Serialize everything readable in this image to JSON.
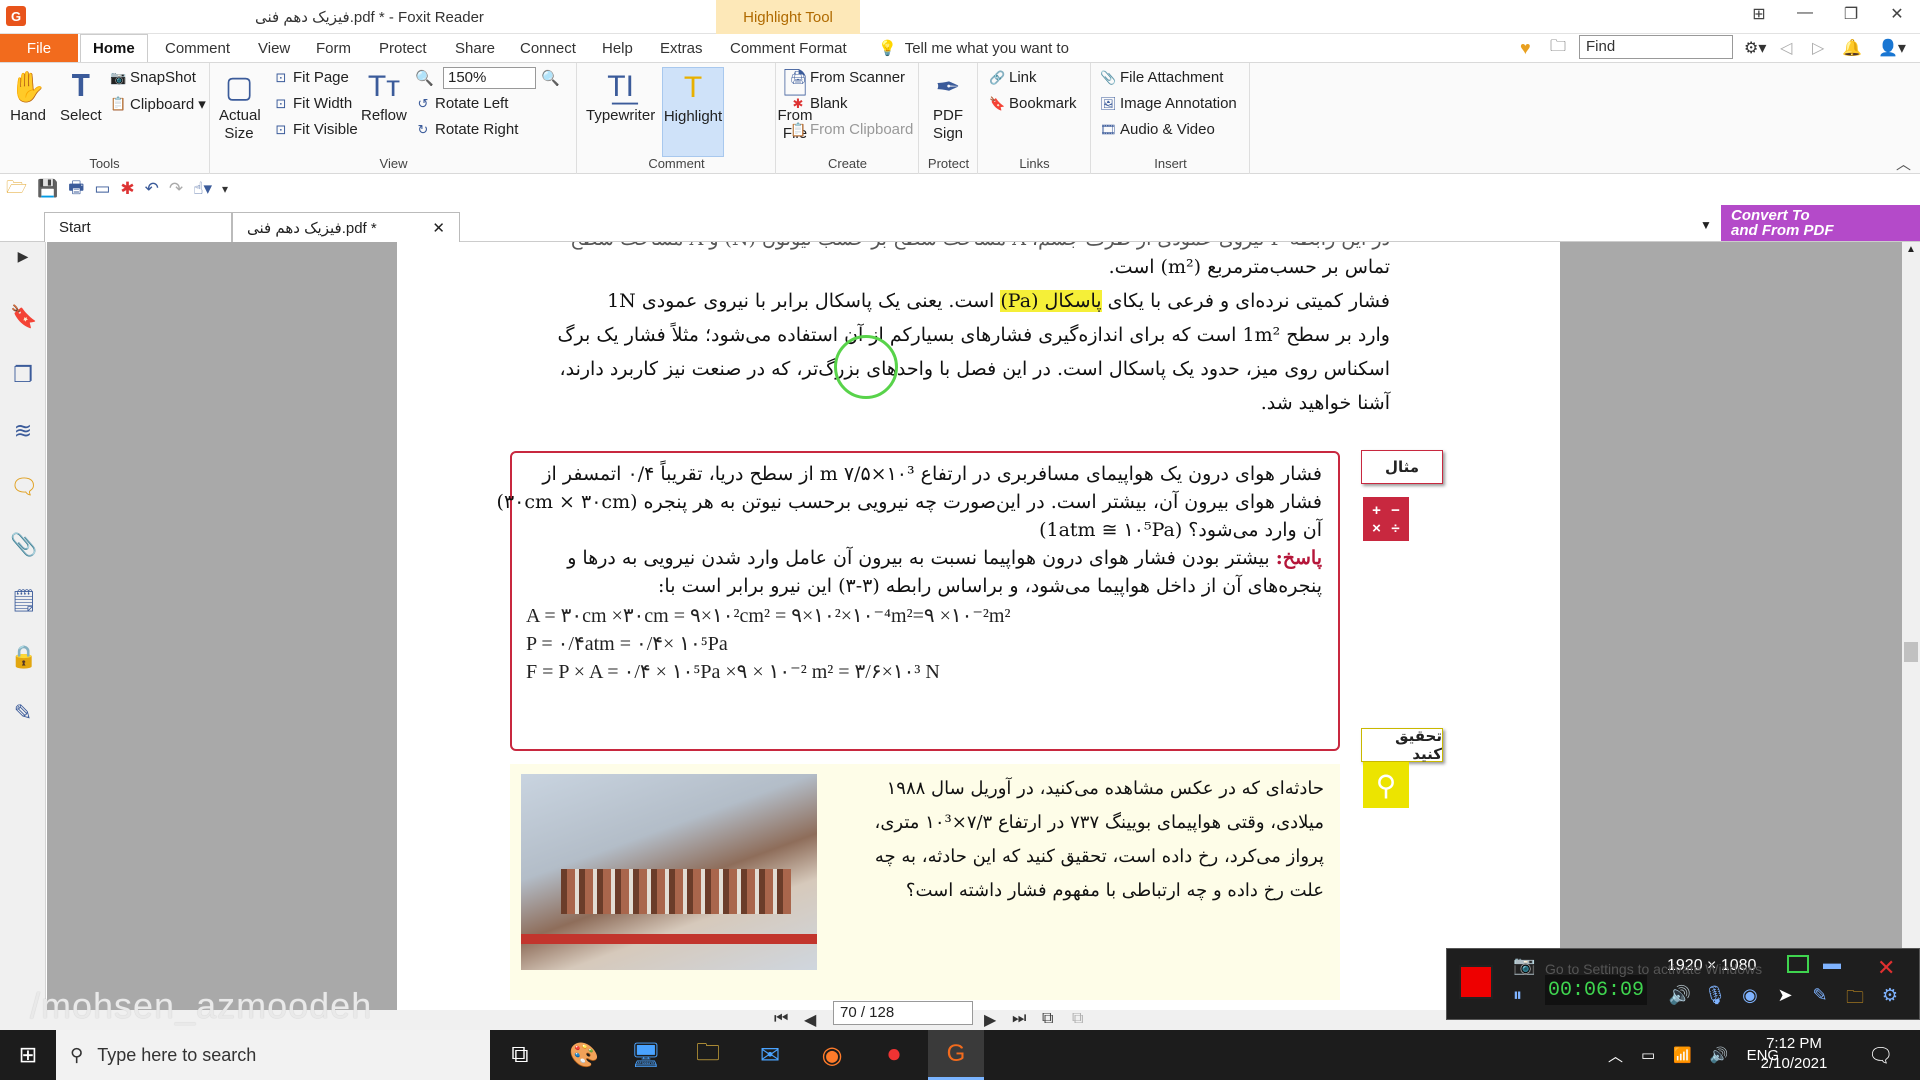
{
  "titlebar": {
    "app_icon": "foxit-logo",
    "title": "فیزیک دهم فنی.pdf * - Foxit Reader",
    "context_tab": "Highlight Tool"
  },
  "menu": {
    "file": "File",
    "tabs": [
      "Home",
      "Comment",
      "View",
      "Form",
      "Protect",
      "Share",
      "Connect",
      "Help",
      "Extras",
      "Comment Format"
    ],
    "tell_me": "Tell me what you want to",
    "find_placeholder": "Find"
  },
  "ribbon": {
    "tools": {
      "label": "Tools",
      "hand": "Hand",
      "select": "Select",
      "snapshot": "SnapShot",
      "clipboard": "Clipboard"
    },
    "view": {
      "label": "View",
      "actual_size": "Actual Size",
      "fit_page": "Fit Page",
      "fit_width": "Fit Width",
      "fit_visible": "Fit Visible",
      "reflow": "Reflow",
      "zoom": "150%",
      "rotate_left": "Rotate Left",
      "rotate_right": "Rotate Right"
    },
    "comment": {
      "label": "Comment",
      "typewriter": "Typewriter",
      "highlight": "Highlight"
    },
    "create": {
      "label": "Create",
      "from_file": "From File",
      "from_scanner": "From Scanner",
      "blank": "Blank",
      "from_clipboard": "From Clipboard"
    },
    "protect": {
      "label": "Protect",
      "pdf_sign": "PDF Sign"
    },
    "links": {
      "label": "Links",
      "link": "Link",
      "bookmark": "Bookmark"
    },
    "insert": {
      "label": "Insert",
      "file_attachment": "File Attachment",
      "image_annotation": "Image Annotation",
      "audio_video": "Audio & Video"
    }
  },
  "tabs": {
    "start": "Start",
    "doc": "فیزیک دهم فنی.pdf *",
    "convert_line1": "Convert To",
    "convert_line2": "and From PDF"
  },
  "page": {
    "top_cut": "در این رابطه F نیروی عمودی از طرف جسم، A مساحت سطح بر حسب نیوتون (N) و A مساحت سطح",
    "p_line1": "تماس بر حسب‌مترمربع (m²) است.",
    "p_line2_a": "فشار کمیتی نرده‌ای و فرعی با یکای ",
    "p_line2_mark": "پاسکال (Pa)",
    "p_line2_b": " است. یعنی یک پاسکال برابر با نیروی عمودی 1N",
    "p_line3": "وارد بر سطح 1m² است که برای اندازه‌گیری فشارهای بسیارکم از آن استفاده می‌شود؛ مثلاً فشار یک برگ",
    "p_line4": "اسکناس روی میز، حدود یک پاسکال است. در این فصل با واحدهای بزرگ‌تر، که در صنعت نیز کاربرد دارند،",
    "p_line5": "آشنا خواهید شد.",
    "example_label": "مثال",
    "ex_line1": "فشار هوای درون یک هواپیمای مسافربری در ارتفاع m ۷/۵×۱۰³ از سطح دریا، تقریباً ۰/۴ اتمسفر از",
    "ex_line2": "فشار هوای بیرون آن، بیشتر است. در این‌صورت چه نیرویی برحسب نیوتن به هر پنجره (۳۰cm × ۳۰cm)",
    "ex_line3": "آن وارد می‌شود؟ (1atm ≅ ۱۰⁵Pa)",
    "ans_label": "پاسخ:",
    "ans_line1": " بیشتر بودن فشار هوای درون هواپیما نسبت به بیرون آن عامل وارد شدن نیرویی به درها و",
    "ans_line2": "پنجره‌های آن از داخل هواپیما می‌شود، و براساس رابطه (۳-۳) این نیرو برابر است با:",
    "eq1": "A = ۳۰cm ×۳۰cm = ۹×۱۰²cm² = ۹×۱۰²×۱۰⁻⁴m²=۹ ×۱۰⁻²m²",
    "eq2": "P = ۰/۴atm = ۰/۴× ۱۰⁵Pa",
    "eq3": "F = P × A = ۰/۴ × ۱۰⁵Pa ×۹ × ۱۰⁻² m² = ۳/۶×۱۰³ N",
    "investigate_label": "تحقیق کنید",
    "inv_line1": "حادثه‌ای که در عکس مشاهده می‌کنید، در آوریل سال ۱۹۸۸",
    "inv_line2": "میلادی، وقتی هواپیمای بویینگ ۷۳۷ در ارتفاع ۷/۳×۱۰³ متری،",
    "inv_line3": "پرواز می‌کرد، رخ داده است، تحقیق کنید که این حادثه، به چه",
    "inv_line4": "علت رخ داده و چه ارتباطی با مفهوم فشار داشته است؟"
  },
  "nav": {
    "page_value": "70 / 128"
  },
  "watermark": "/mohsen_azmoodeh",
  "recorder": {
    "timer": "00:06:09",
    "resolution": "1920 × 1080",
    "overlay": "Go to Settings to activate Windows"
  },
  "taskbar": {
    "search_placeholder": "Type here to search",
    "lang": "ENG",
    "time": "7:12 PM",
    "date": "2/10/2021"
  },
  "colors": {
    "file_tab": "#f26b1d",
    "example_border": "#c8283f",
    "highlight_mark": "#f5ef38",
    "investigate_bg": "#fefde8"
  }
}
